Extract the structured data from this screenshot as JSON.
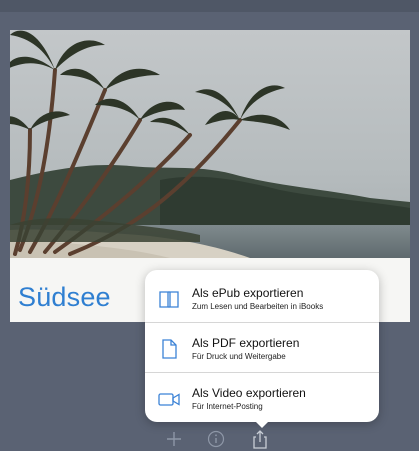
{
  "card": {
    "title": "Südsee"
  },
  "export_menu": {
    "items": [
      {
        "label": "Als ePub exportieren",
        "subtitle": "Zum Lesen und Bearbeiten in iBooks",
        "icon": "book-icon"
      },
      {
        "label": "Als PDF exportieren",
        "subtitle": "Für Druck und Weitergabe",
        "icon": "document-icon"
      },
      {
        "label": "Als Video exportieren",
        "subtitle": "Für Internet-Posting",
        "icon": "video-camera-icon"
      }
    ]
  },
  "toolbar": {
    "icons": [
      "plus-icon",
      "info-icon",
      "share-icon"
    ]
  },
  "colors": {
    "accent": "#2f7fd1",
    "icon": "#3b82d6",
    "background": "#5a6273"
  }
}
